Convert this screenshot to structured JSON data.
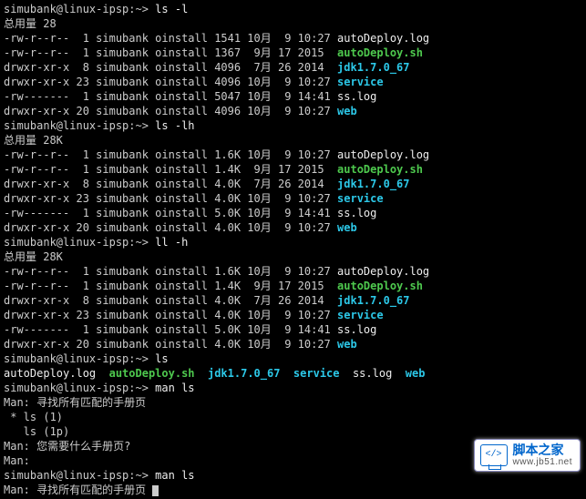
{
  "prompt": "simubank@linux-ipsp:~>",
  "commands": {
    "ls_l": "ls -l",
    "ls_lh": "ls -lh",
    "ll_h": "ll -h",
    "ls": "ls",
    "man_ls": "man ls"
  },
  "totals": {
    "t28": "总用量 28",
    "t28k": "总用量 28K"
  },
  "listings": {
    "plain": [
      {
        "perm": "-rw-r--r--",
        "links": "1",
        "user": "simubank",
        "group": "oinstall",
        "size": "1541",
        "month": "10月",
        "day": "9",
        "time": "10:27",
        "name": "autoDeploy.log",
        "cls": "white"
      },
      {
        "perm": "-rw-r--r--",
        "links": "1",
        "user": "simubank",
        "group": "oinstall",
        "size": "1367",
        "month": "9月",
        "day": "17",
        "time": "2015",
        "name": "autoDeploy.sh",
        "cls": "green"
      },
      {
        "perm": "drwxr-xr-x",
        "links": "8",
        "user": "simubank",
        "group": "oinstall",
        "size": "4096",
        "month": "7月",
        "day": "26",
        "time": "2014",
        "name": "jdk1.7.0_67",
        "cls": "cyan"
      },
      {
        "perm": "drwxr-xr-x",
        "links": "23",
        "user": "simubank",
        "group": "oinstall",
        "size": "4096",
        "month": "10月",
        "day": "9",
        "time": "10:27",
        "name": "service",
        "cls": "cyan"
      },
      {
        "perm": "-rw-------",
        "links": "1",
        "user": "simubank",
        "group": "oinstall",
        "size": "5047",
        "month": "10月",
        "day": "9",
        "time": "14:41",
        "name": "ss.log",
        "cls": "white"
      },
      {
        "perm": "drwxr-xr-x",
        "links": "20",
        "user": "simubank",
        "group": "oinstall",
        "size": "4096",
        "month": "10月",
        "day": "9",
        "time": "10:27",
        "name": "web",
        "cls": "cyan"
      }
    ],
    "human": [
      {
        "perm": "-rw-r--r--",
        "links": "1",
        "user": "simubank",
        "group": "oinstall",
        "size": "1.6K",
        "month": "10月",
        "day": "9",
        "time": "10:27",
        "name": "autoDeploy.log",
        "cls": "white"
      },
      {
        "perm": "-rw-r--r--",
        "links": "1",
        "user": "simubank",
        "group": "oinstall",
        "size": "1.4K",
        "month": "9月",
        "day": "17",
        "time": "2015",
        "name": "autoDeploy.sh",
        "cls": "green"
      },
      {
        "perm": "drwxr-xr-x",
        "links": "8",
        "user": "simubank",
        "group": "oinstall",
        "size": "4.0K",
        "month": "7月",
        "day": "26",
        "time": "2014",
        "name": "jdk1.7.0_67",
        "cls": "cyan"
      },
      {
        "perm": "drwxr-xr-x",
        "links": "23",
        "user": "simubank",
        "group": "oinstall",
        "size": "4.0K",
        "month": "10月",
        "day": "9",
        "time": "10:27",
        "name": "service",
        "cls": "cyan"
      },
      {
        "perm": "-rw-------",
        "links": "1",
        "user": "simubank",
        "group": "oinstall",
        "size": "5.0K",
        "month": "10月",
        "day": "9",
        "time": "14:41",
        "name": "ss.log",
        "cls": "white"
      },
      {
        "perm": "drwxr-xr-x",
        "links": "20",
        "user": "simubank",
        "group": "oinstall",
        "size": "4.0K",
        "month": "10月",
        "day": "9",
        "time": "10:27",
        "name": "web",
        "cls": "cyan"
      }
    ]
  },
  "ls_row": [
    {
      "text": "autoDeploy.log",
      "cls": "white"
    },
    {
      "text": "autoDeploy.sh",
      "cls": "green"
    },
    {
      "text": "jdk1.7.0_67",
      "cls": "cyan"
    },
    {
      "text": "service",
      "cls": "cyan"
    },
    {
      "text": "ss.log",
      "cls": "white"
    },
    {
      "text": "web",
      "cls": "cyan"
    }
  ],
  "man": {
    "search": "Man: 寻找所有匹配的手册页",
    "star": " * ls (1)",
    "alt": "   ls (1p)",
    "prompt": "Man: 您需要什么手册页?",
    "reply": "Man:"
  },
  "watermark": {
    "cn": "脚本之家",
    "url": "www.jb51.net",
    "glyph": "</>"
  }
}
